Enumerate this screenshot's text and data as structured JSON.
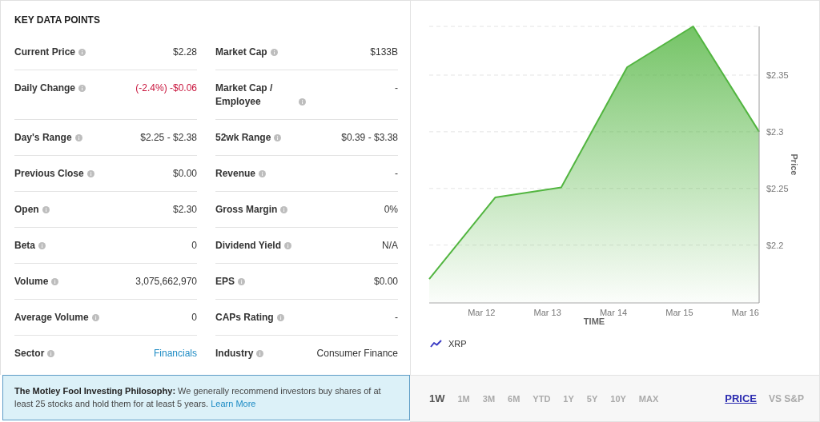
{
  "key_data": {
    "title": "KEY DATA POINTS",
    "items": [
      {
        "label": "Current Price",
        "value": "$2.28",
        "kind": "plain"
      },
      {
        "label": "Market Cap",
        "value": "$133B",
        "kind": "plain"
      },
      {
        "label": "Daily Change",
        "value": "(-2.4%) -$0.06",
        "kind": "negative"
      },
      {
        "label": "Market Cap / Employee",
        "value": "-",
        "kind": "plain"
      },
      {
        "label": "Day's Range",
        "value": "$2.25 - $2.38",
        "kind": "plain"
      },
      {
        "label": "52wk Range",
        "value": "$0.39 - $3.38",
        "kind": "plain"
      },
      {
        "label": "Previous Close",
        "value": "$0.00",
        "kind": "plain"
      },
      {
        "label": "Revenue",
        "value": "-",
        "kind": "plain"
      },
      {
        "label": "Open",
        "value": "$2.30",
        "kind": "plain"
      },
      {
        "label": "Gross Margin",
        "value": "0%",
        "kind": "plain"
      },
      {
        "label": "Beta",
        "value": "0",
        "kind": "plain"
      },
      {
        "label": "Dividend Yield",
        "value": "N/A",
        "kind": "plain"
      },
      {
        "label": "Volume",
        "value": "3,075,662,970",
        "kind": "plain"
      },
      {
        "label": "EPS",
        "value": "$0.00",
        "kind": "plain"
      },
      {
        "label": "Average Volume",
        "value": "0",
        "kind": "plain"
      },
      {
        "label": "CAPs Rating",
        "value": "-",
        "kind": "plain"
      },
      {
        "label": "Sector",
        "value": "Financials",
        "kind": "link"
      },
      {
        "label": "Industry",
        "value": "Consumer Finance",
        "kind": "plain"
      }
    ]
  },
  "chart": {
    "chart_data": {
      "type": "area",
      "xlabel": "TIME",
      "ylabel": "Price",
      "categories": [
        null,
        "Mar 12",
        "Mar 13",
        "Mar 14",
        "Mar 15",
        "Mar 16"
      ],
      "ylim": [
        2.149,
        2.393
      ],
      "yticks": [
        {
          "value": 2.2,
          "label": "$2.2"
        },
        {
          "value": 2.25,
          "label": "$2.25"
        },
        {
          "value": 2.3,
          "label": "$2.3"
        },
        {
          "value": 2.35,
          "label": "$2.35"
        }
      ],
      "grid": true,
      "series": [
        {
          "name": "XRP",
          "color": "#52b540",
          "values": [
            2.17,
            2.242,
            2.251,
            2.357,
            2.393,
            2.3
          ]
        }
      ]
    }
  },
  "philosophy": {
    "text": "**The Motley Fool Investing Philosophy:** We generally recommend investors buy shares of at least 25 stocks and hold them for at least 5 years.",
    "link": "Learn More"
  },
  "controls": {
    "ranges": [
      {
        "label": "1W",
        "selected": true
      },
      {
        "label": "1M",
        "selected": false
      },
      {
        "label": "3M",
        "selected": false
      },
      {
        "label": "6M",
        "selected": false
      },
      {
        "label": "YTD",
        "selected": false
      },
      {
        "label": "1Y",
        "selected": false
      },
      {
        "label": "5Y",
        "selected": false
      },
      {
        "label": "10Y",
        "selected": false
      },
      {
        "label": "MAX",
        "selected": false
      }
    ],
    "views": [
      {
        "label": "PRICE",
        "selected": true
      },
      {
        "label": "VS S&P",
        "selected": false
      }
    ]
  }
}
